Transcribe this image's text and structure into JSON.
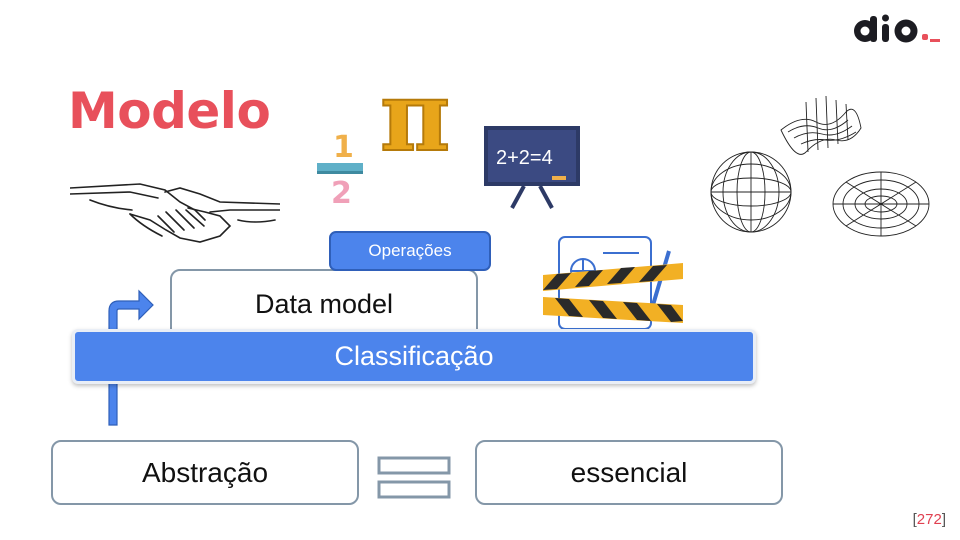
{
  "slide": {
    "title": "Modelo",
    "logo_text": "dio",
    "page_number": "272"
  },
  "concepts": {
    "abstraction": "Abstração",
    "equals_symbol": "equals-icon",
    "essential": "essencial",
    "classification": "Classificação",
    "data_model": "Data model",
    "operations": "Operações"
  },
  "illustrations": {
    "fraction_top": "1",
    "fraction_bottom": "2",
    "pi_symbol": "π",
    "board_text": "2+2=4"
  },
  "colors": {
    "title": "#e8505b",
    "accent_blue": "#4c84ec",
    "box_border": "#8497a8"
  }
}
